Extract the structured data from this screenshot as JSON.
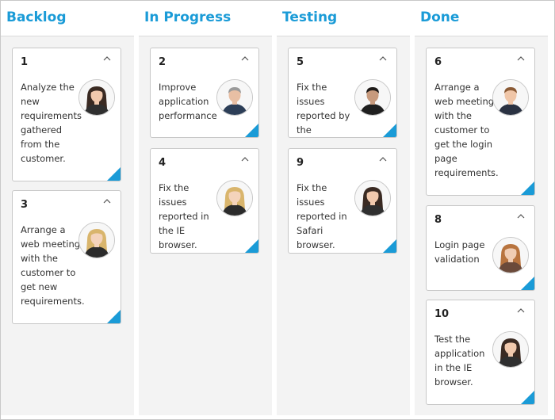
{
  "board": {
    "accent_color": "#1a9bd7",
    "columns": [
      {
        "title": "Backlog",
        "cards": [
          {
            "id": "1",
            "text": "Analyze the new requirements gathered from the customer.",
            "avatar": "woman-dark-hair"
          },
          {
            "id": "3",
            "text": "Arrange a web meeting with the customer to get new requirements.",
            "avatar": "woman-blonde"
          }
        ]
      },
      {
        "title": "In Progress",
        "cards": [
          {
            "id": "2",
            "text": "Improve application performance",
            "avatar": "man-gray-hair"
          },
          {
            "id": "4",
            "text": "Fix the issues reported in the IE browser.",
            "avatar": "woman-blonde"
          }
        ]
      },
      {
        "title": "Testing",
        "cards": [
          {
            "id": "5",
            "text": "Fix the issues reported by the customer.",
            "avatar": "man-dark-hair"
          },
          {
            "id": "9",
            "text": "Fix the issues reported in Safari browser.",
            "avatar": "woman-dark-hair"
          }
        ]
      },
      {
        "title": "Done",
        "cards": [
          {
            "id": "6",
            "text": "Arrange a web meeting with the customer to get the login page requirements.",
            "avatar": "man-brown-hair"
          },
          {
            "id": "8",
            "text": "Login page validation",
            "avatar": "woman-red-hair"
          },
          {
            "id": "10",
            "text": "Test the application in the IE browser.",
            "avatar": "woman-dark-hair"
          }
        ]
      }
    ]
  }
}
